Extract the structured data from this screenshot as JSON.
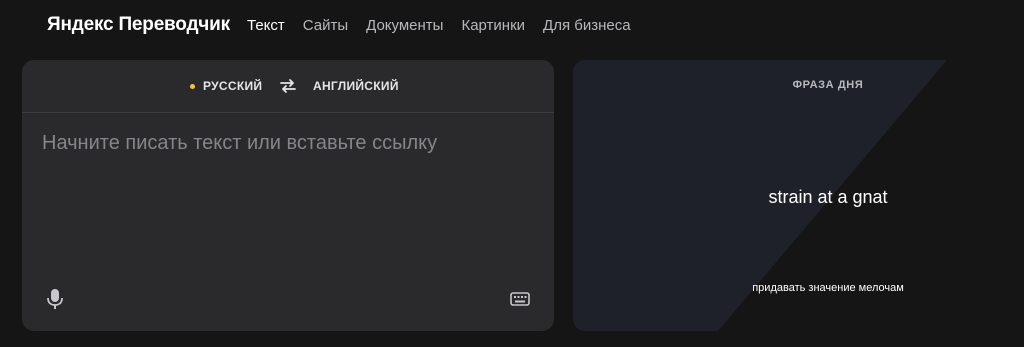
{
  "header": {
    "logo": "Яндекс Переводчик",
    "nav": [
      {
        "label": "Текст",
        "active": true
      },
      {
        "label": "Сайты",
        "active": false
      },
      {
        "label": "Документы",
        "active": false
      },
      {
        "label": "Картинки",
        "active": false
      },
      {
        "label": "Для бизнеса",
        "active": false
      }
    ]
  },
  "translator": {
    "source_lang": "РУССКИЙ",
    "target_lang": "АНГЛИЙСКИЙ",
    "input_value": "",
    "input_placeholder": "Начните писать текст или вставьте ссылку",
    "icons": [
      "swap-icon",
      "microphone-icon",
      "keyboard-icon"
    ]
  },
  "phrase_of_day": {
    "title": "ФРАЗА ДНЯ",
    "phrase": "strain at a gnat",
    "translation": "придавать значение мелочам"
  },
  "colors": {
    "background": "#151516",
    "panel": "#2a2a2c",
    "accent_dot": "#f6c23b",
    "phrase_panel": "#1e2129"
  }
}
